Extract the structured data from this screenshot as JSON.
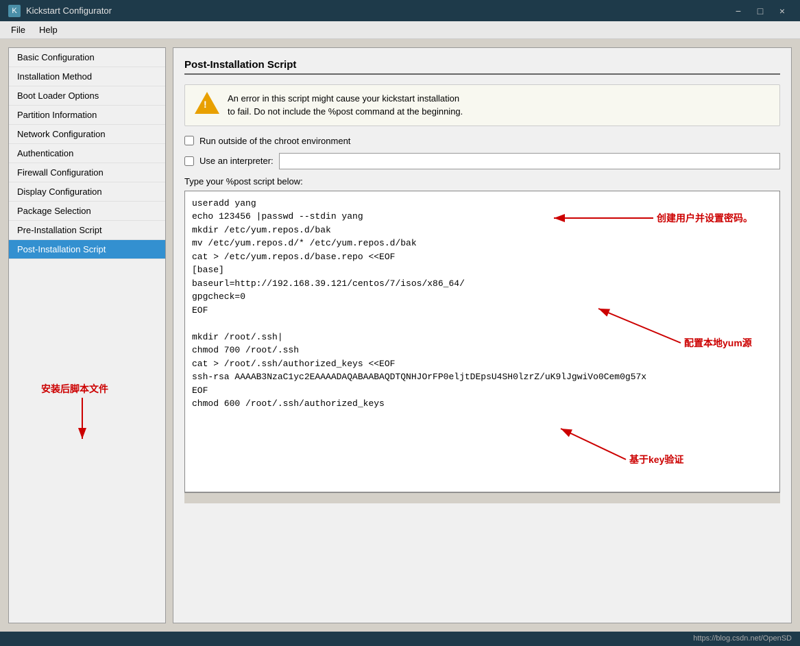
{
  "titleBar": {
    "appName": "Kickstart Configurator",
    "appIconText": "K",
    "minimizeBtn": "−",
    "maximizeBtn": "□",
    "closeBtn": "×"
  },
  "menuBar": {
    "items": [
      {
        "label": "File"
      },
      {
        "label": "Help"
      }
    ]
  },
  "sidebar": {
    "items": [
      {
        "label": "Basic Configuration",
        "active": false,
        "bold": false
      },
      {
        "label": "Installation Method",
        "active": false,
        "bold": false
      },
      {
        "label": "Boot Loader Options",
        "active": false,
        "bold": false
      },
      {
        "label": "Partition Information",
        "active": false,
        "bold": false
      },
      {
        "label": "Network Configuration",
        "active": false,
        "bold": false
      },
      {
        "label": "Authentication",
        "active": false,
        "bold": false
      },
      {
        "label": "Firewall Configuration",
        "active": false,
        "bold": false
      },
      {
        "label": "Display Configuration",
        "active": false,
        "bold": false
      },
      {
        "label": "Package Selection",
        "active": false,
        "bold": false
      },
      {
        "label": "Pre-Installation Script",
        "active": false,
        "bold": false
      },
      {
        "label": "Post-Installation Script",
        "active": true,
        "bold": false
      }
    ]
  },
  "content": {
    "sectionTitle": "Post-Installation Script",
    "warning": {
      "text": "An error in this script might cause your kickstart installation\nto fail. Do not include the %post command at the beginning."
    },
    "checkboxChroot": {
      "label": "Run outside of the chroot environment",
      "checked": false
    },
    "checkboxInterpreter": {
      "label": "Use an interpreter:",
      "checked": false,
      "inputValue": ""
    },
    "scriptTypeLabel": "Type your %post script below:",
    "scriptContent": "useradd yang\necho 123456 |passwd --stdin yang\nmkdir /etc/yum.repos.d/bak\nmv /etc/yum.repos.d/* /etc/yum.repos.d/bak\ncat > /etc/yum.repos.d/base.repo <<EOF\n[base]\nbaseurl=http://192.168.39.121/centos/7/isos/x86_64/\ngpgcheck=0\nEOF\n\nmkdir /root/.ssh|\nchmod 700 /root/.ssh\ncat > /root/.ssh/authorized_keys <<EOF\nssh-rsa AAAAB3NzaC1yc2EAAAADAQABAABAQDTQNHJOrFP0eljtDEpsU4SH0lzrZ/uK9lJgwiVo0Cem0g57x\nEOF\nchmod 600 /root/.ssh/authorized_keys"
  },
  "annotations": {
    "createUser": "创建用户并设置密码。",
    "configureYum": "配置本地yum源",
    "keyAuth": "基于key验证",
    "sidebarNote": "安装后脚本文件"
  },
  "bottomBar": {
    "url": "https://blog.csdn.net/OpenSD"
  }
}
